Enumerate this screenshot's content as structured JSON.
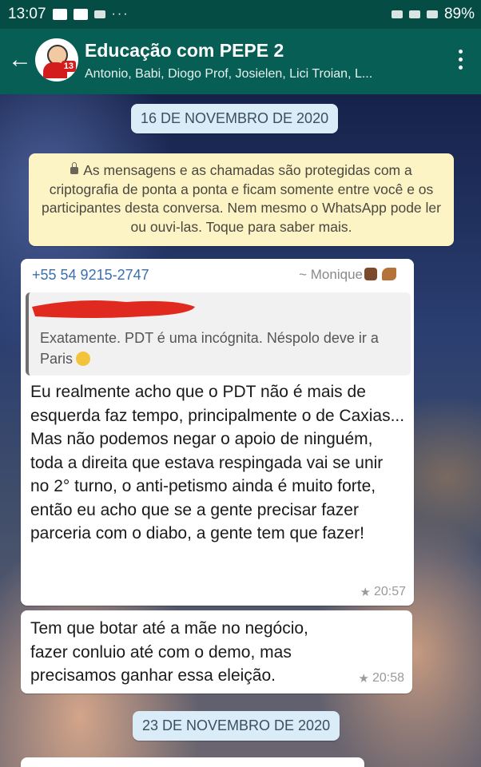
{
  "statusbar": {
    "time": "13:07",
    "dots": "···",
    "battery": "89%"
  },
  "header": {
    "title": "Educação com PEPE 2",
    "subtitle": "Antonio, Babi, Diogo Prof, Josielen, Lici Troian, L...",
    "avatar_badge": "13"
  },
  "chat": {
    "date_1": "16 DE NOVEMBRO DE 2020",
    "encryption_notice": "As mensagens e as chamadas são protegidas com a criptografia de ponta a ponta e ficam somente entre você e os participantes desta conversa. Nem mesmo o WhatsApp pode ler ou ouvi-las. Toque para saber mais.",
    "messages": [
      {
        "sender_number": "+55 54 9215-2747",
        "sender_name": "~ Monique",
        "quote_text": "Exatamente. PDT é uma incógnita. Néspolo deve ir a Paris",
        "text": "Eu realmente acho que o PDT não é mais de esquerda faz tempo, principalmente o de Caxias... Mas não podemos negar o apoio de ninguém, toda a direita que estava respingada vai se unir no 2° turno, o anti-petismo ainda é muito forte, então eu acho que se a gente precisar fazer parceria com o diabo, a gente tem que fazer!",
        "time": "20:57",
        "starred": true
      },
      {
        "text": "Tem que botar até a mãe no negócio, fazer conluio até com o demo, mas precisamos ganhar essa eleição.",
        "time": "20:58",
        "starred": true
      }
    ],
    "date_2": "23 DE NOVEMBRO DE 2020"
  },
  "colors": {
    "header": "#075e54",
    "statusbar": "#054d44",
    "sender": "#3a6fb0"
  }
}
